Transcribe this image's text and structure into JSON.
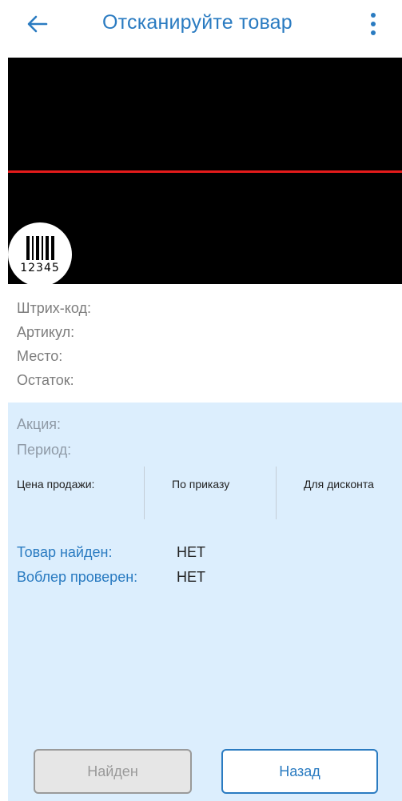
{
  "header": {
    "title": "Отсканируйте товар",
    "back_icon": "arrow-left-icon",
    "menu_icon": "more-vertical-icon",
    "accent_color": "#2a7bc1"
  },
  "scanner": {
    "barcode_digits": "12345",
    "scan_line_color": "#e41b1b"
  },
  "info": {
    "barcode_label": "Штрих-код:",
    "article_label": "Артикул:",
    "place_label": "Место:",
    "stock_label": "Остаток:"
  },
  "promo": {
    "action_label": "Акция:",
    "period_label": "Период:",
    "price_columns": [
      "Цена продажи:",
      "По приказу",
      "Для дисконта"
    ],
    "background_color": "#dceefd"
  },
  "status": {
    "found_label": "Товар найден:",
    "found_value": "НЕТ",
    "checked_label": "Воблер проверен:",
    "checked_value": "НЕТ"
  },
  "buttons": {
    "found_label": "Найден",
    "back_label": "Назад"
  }
}
